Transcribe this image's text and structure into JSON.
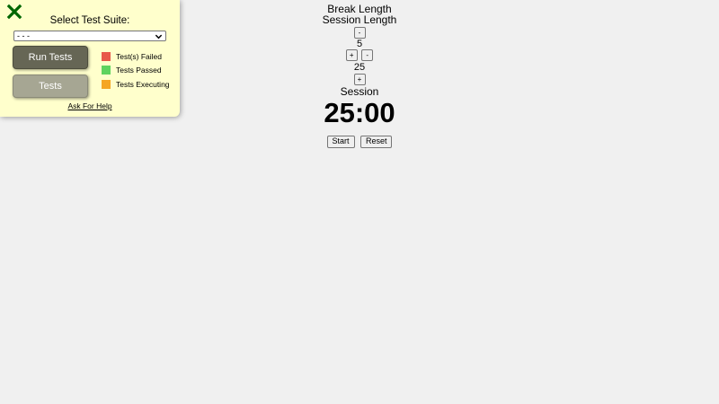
{
  "test_panel": {
    "select_label": "Select Test Suite:",
    "select_value": "- - -",
    "run_button": "Run Tests",
    "tests_button": "Tests",
    "legend": [
      {
        "label": "Test(s) Failed",
        "color": "#e8584a"
      },
      {
        "label": "Tests Passed",
        "color": "#5fd35f"
      },
      {
        "label": "Tests Executing",
        "color": "#f5a623"
      }
    ],
    "help_link": "Ask For Help",
    "close_icon": "close-x-icon",
    "close_color": "#006600"
  },
  "clock": {
    "break_label": "Break Length",
    "session_label": "Session Length",
    "break_decrement": "-",
    "break_value": "5",
    "break_increment": "+",
    "session_decrement": "-",
    "session_value": "25",
    "session_increment": "+",
    "timer_label": "Session",
    "time_left": "25:00",
    "start_button": "Start",
    "reset_button": "Reset"
  }
}
